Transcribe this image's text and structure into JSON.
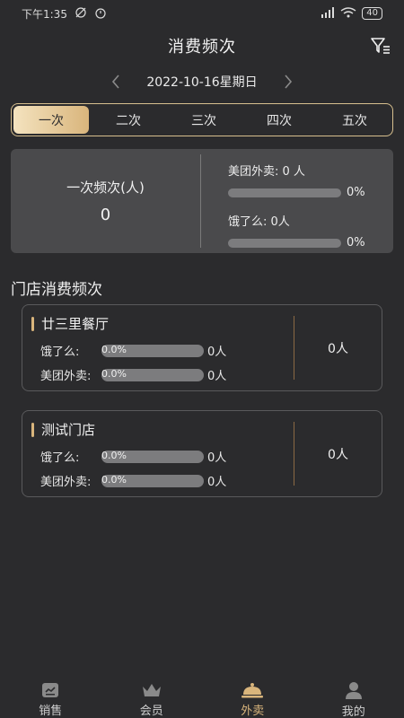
{
  "status_bar": {
    "time": "下午1:35",
    "battery": "40"
  },
  "header": {
    "title": "消费频次"
  },
  "date_nav": {
    "date": "2022-10-16星期日"
  },
  "tabs": [
    {
      "label": "一次",
      "active": true
    },
    {
      "label": "二次",
      "active": false
    },
    {
      "label": "三次",
      "active": false
    },
    {
      "label": "四次",
      "active": false
    },
    {
      "label": "五次",
      "active": false
    }
  ],
  "summary": {
    "left_label": "一次频次(人)",
    "left_value": "0",
    "meituan_label": "美团外卖: 0 人",
    "meituan_pct": "0%",
    "meituan_fill": 0,
    "eleme_label": "饿了么: 0人",
    "eleme_pct": "0%",
    "eleme_fill": 0
  },
  "section_title": "门店消费频次",
  "stores": [
    {
      "name": "廿三里餐厅",
      "stats": [
        {
          "label": "饿了么:",
          "pct": "0.0%",
          "count": "0人"
        },
        {
          "label": "美团外卖:",
          "pct": "0.0%",
          "count": "0人"
        }
      ],
      "total": "0人"
    },
    {
      "name": "测试门店",
      "stats": [
        {
          "label": "饿了么:",
          "pct": "0.0%",
          "count": "0人"
        },
        {
          "label": "美团外卖:",
          "pct": "0.0%",
          "count": "0人"
        }
      ],
      "total": "0人"
    }
  ],
  "bottom_nav": [
    {
      "label": "销售",
      "icon": "sales-icon",
      "active": false
    },
    {
      "label": "会员",
      "icon": "crown-icon",
      "active": false
    },
    {
      "label": "外卖",
      "icon": "food-cover-icon",
      "active": true
    },
    {
      "label": "我的",
      "icon": "user-icon",
      "active": false
    }
  ],
  "colors": {
    "accent": "#d9b57c",
    "background": "#2b2b2d",
    "card": "#4a4a4c"
  }
}
